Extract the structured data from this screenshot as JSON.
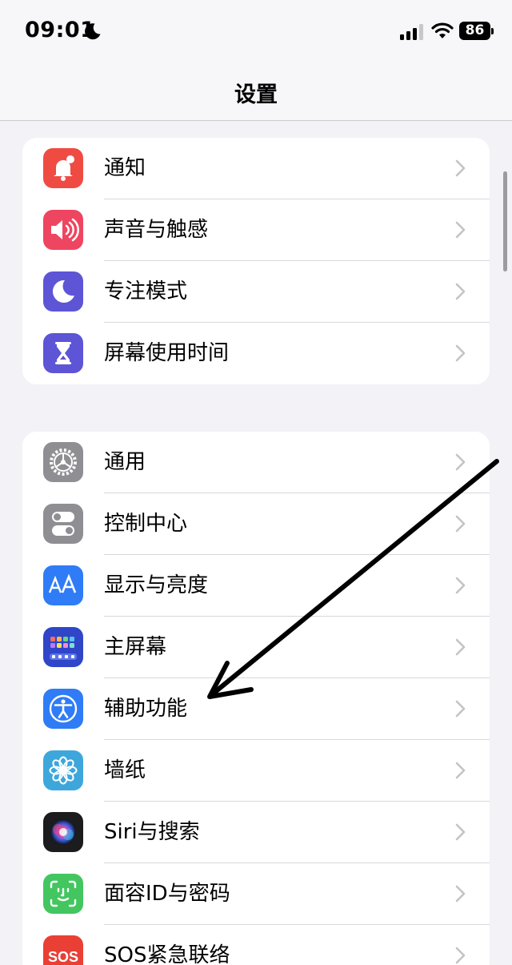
{
  "status_bar": {
    "time": "09:01",
    "battery": "86"
  },
  "nav": {
    "title": "设置"
  },
  "groups": [
    {
      "items": [
        {
          "label": "通知",
          "icon": "bell-badge-icon",
          "color": "#ef4b43"
        },
        {
          "label": "声音与触感",
          "icon": "speaker-icon",
          "color": "#ee4560"
        },
        {
          "label": "专注模式",
          "icon": "moon-icon",
          "color": "#5d55d6"
        },
        {
          "label": "屏幕使用时间",
          "icon": "hourglass-icon",
          "color": "#5d55d6"
        }
      ]
    },
    {
      "items": [
        {
          "label": "通用",
          "icon": "gear-icon",
          "color": "#8e8e93"
        },
        {
          "label": "控制中心",
          "icon": "toggles-icon",
          "color": "#8e8e93"
        },
        {
          "label": "显示与亮度",
          "icon": "text-size-icon",
          "color": "#2f7cf6"
        },
        {
          "label": "主屏幕",
          "icon": "home-grid-icon",
          "color": "#2f46c8"
        },
        {
          "label": "辅助功能",
          "icon": "accessibility-icon",
          "color": "#2f7cf6"
        },
        {
          "label": "墙纸",
          "icon": "flower-icon",
          "color": "#3da7dc"
        },
        {
          "label": "Siri与搜索",
          "icon": "siri-icon",
          "color": "#1c1c1e"
        },
        {
          "label": "面容ID与密码",
          "icon": "face-id-icon",
          "color": "#43c660"
        },
        {
          "label": "SOS紧急联络",
          "icon": "sos-icon",
          "color": "#ea3f35",
          "icon_text": "SOS"
        }
      ]
    }
  ]
}
